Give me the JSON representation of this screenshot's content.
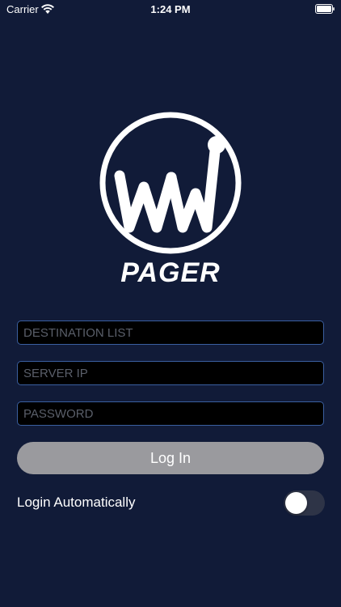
{
  "status_bar": {
    "carrier": "Carrier",
    "time": "1:24 PM",
    "wifi_icon": "wifi-icon",
    "battery_icon": "battery-icon"
  },
  "logo": {
    "icon": "ww-logo-icon",
    "name": "PAGER"
  },
  "form": {
    "destination_placeholder": "DESTINATION LIST",
    "destination_value": "",
    "server_placeholder": "SERVER IP",
    "server_value": "",
    "password_placeholder": "PASSWORD",
    "password_value": ""
  },
  "login_button": {
    "label": "Log In"
  },
  "auto_login": {
    "label": "Login Automatically",
    "enabled": false
  },
  "colors": {
    "background": "#111b38",
    "field_border": "#3a5fa0",
    "button": "#9a9a9e",
    "toggle_off": "#2e3447"
  }
}
